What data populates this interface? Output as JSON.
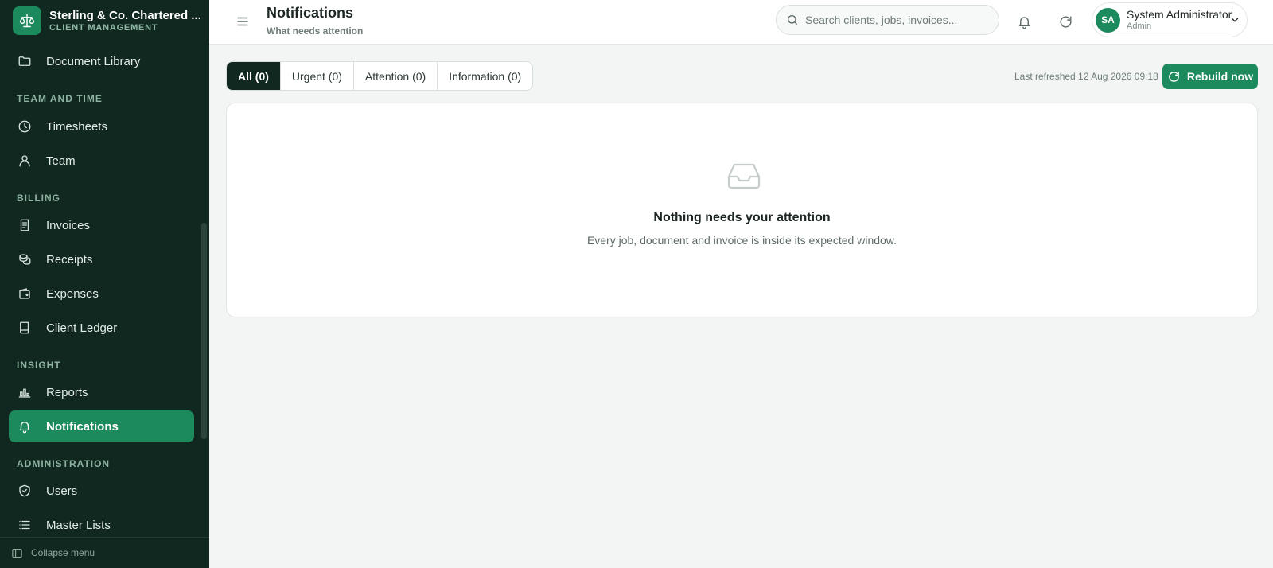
{
  "brand": {
    "name": "Sterling & Co. Chartered ...",
    "subtitle": "CLIENT MANAGEMENT"
  },
  "sidebar": {
    "items": [
      {
        "label": "Document Library",
        "icon": "folder-icon"
      },
      {
        "label": "Timesheets",
        "icon": "clock-icon"
      },
      {
        "label": "Team",
        "icon": "user-icon"
      },
      {
        "label": "Invoices",
        "icon": "invoice-icon"
      },
      {
        "label": "Receipts",
        "icon": "coins-icon"
      },
      {
        "label": "Expenses",
        "icon": "wallet-icon"
      },
      {
        "label": "Client Ledger",
        "icon": "book-icon"
      },
      {
        "label": "Reports",
        "icon": "bar-chart-icon"
      },
      {
        "label": "Notifications",
        "icon": "bell-icon",
        "active": true
      },
      {
        "label": "Users",
        "icon": "shield-icon"
      },
      {
        "label": "Master Lists",
        "icon": "list-icon"
      }
    ],
    "sections": {
      "team_and_time": "TEAM AND TIME",
      "billing": "BILLING",
      "insight": "INSIGHT",
      "administration": "ADMINISTRATION"
    },
    "collapse_label": "Collapse menu"
  },
  "header": {
    "title": "Notifications",
    "subtitle": "What needs attention",
    "search_placeholder": "Search clients, jobs, invoices..."
  },
  "user": {
    "initials": "SA",
    "name": "System Administrator",
    "role": "Admin"
  },
  "filters": {
    "tabs": [
      {
        "label": "All (0)",
        "active": true
      },
      {
        "label": "Urgent (0)"
      },
      {
        "label": "Attention (0)"
      },
      {
        "label": "Information (0)"
      }
    ],
    "last_refreshed": "Last refreshed 12 Aug 2026 09:18",
    "rebuild_label": "Rebuild now"
  },
  "empty_state": {
    "title": "Nothing needs your attention",
    "message": "Every job, document and invoice is inside its expected window."
  },
  "colors": {
    "sidebar_bg": "#10281f",
    "accent": "#1c8a5c",
    "page_bg": "#f3f5f4"
  }
}
